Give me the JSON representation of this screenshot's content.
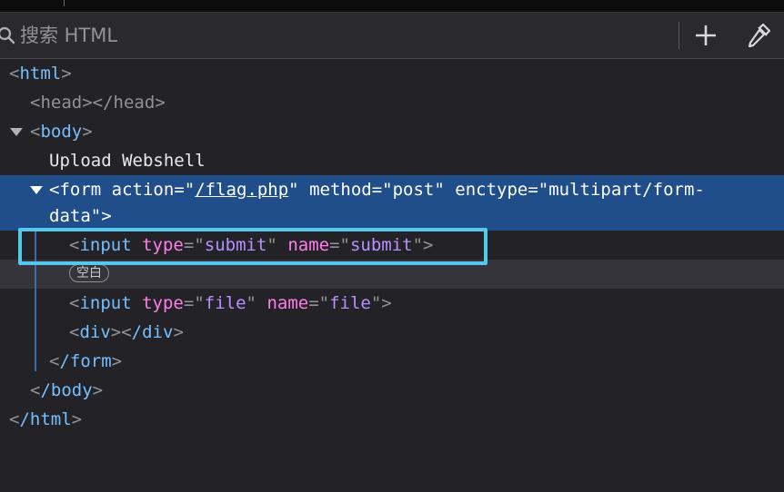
{
  "search": {
    "placeholder": "搜索 HTML"
  },
  "toolbar": {
    "add_icon": "plus-icon",
    "picker_icon": "eyedropper-icon"
  },
  "tree": {
    "html_open": "html",
    "head": {
      "open": "head",
      "close": "/head"
    },
    "body_open": "body",
    "upload_text": "Upload Webshell",
    "form": {
      "tag": "form",
      "attr_action": "action",
      "val_action": "/flag.php",
      "attr_method": "method",
      "val_method": "post",
      "attr_enctype": "enctype",
      "val_enctype_1": "multipart/form-",
      "val_enctype_2": "data"
    },
    "input_submit": {
      "tag": "input",
      "attr_type": "type",
      "val_type": "submit",
      "attr_name": "name",
      "val_name": "submit"
    },
    "whitespace_badge": "空白",
    "input_file": {
      "tag": "input",
      "attr_type": "type",
      "val_type": "file",
      "attr_name": "name",
      "val_name": "file"
    },
    "div": {
      "open": "div",
      "close": "/div"
    },
    "form_close": "/form",
    "body_close": "/body",
    "html_close": "/html"
  },
  "colors": {
    "tag": "#75bfff",
    "attribute": "#ff7de9",
    "value": "#b98eff",
    "selection": "#204e8a",
    "highlight_box": "#55c8f0"
  }
}
